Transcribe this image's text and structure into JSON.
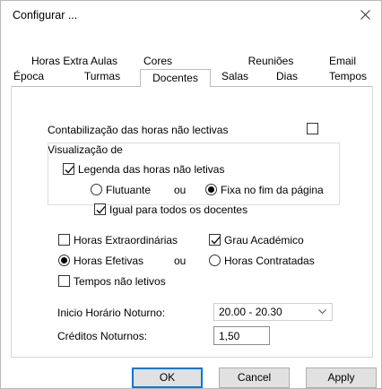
{
  "window": {
    "title": "Configurar ..."
  },
  "tabs_row1": [
    "Horas Extra Aulas",
    "Cores",
    "Reuniões",
    "Email"
  ],
  "tabs_row2": [
    "Época",
    "Turmas",
    "Docentes",
    "Salas",
    "Dias",
    "Tempos"
  ],
  "selected_tab": "Docentes",
  "fields": {
    "contab_label": "Contabilização das horas não lectivas",
    "contab_checked": false,
    "visualizacao_label": "Visualização de",
    "legenda_label": "Legenda das horas não letivas",
    "legenda_checked": true,
    "flutuante_label": "Flutuante",
    "ou1": "ou",
    "fixa_label": "Fixa no fim da página",
    "position_selected": "fixa",
    "igual_label": "Igual para todos os docentes",
    "igual_checked": true,
    "extraord_label": "Horas Extraordinárias",
    "extraord_checked": false,
    "grau_label": "Grau Académico",
    "grau_checked": true,
    "efetivas_label": "Horas Efetivas",
    "ou2": "ou",
    "contratadas_label": "Horas Contratadas",
    "horas_selected": "efetivas",
    "tempos_label": "Tempos não letivos",
    "tempos_checked": false,
    "inicio_label": "Inicio Horário Noturno:",
    "inicio_value": "20.00 - 20.30",
    "creditos_label": "Créditos Noturnos:",
    "creditos_value": "1,50"
  },
  "buttons": {
    "ok": "OK",
    "cancel": "Cancel",
    "apply": "Apply"
  },
  "icons": {
    "close": "close-icon",
    "check": "check-icon",
    "dropdown": "chevron-down-icon"
  }
}
